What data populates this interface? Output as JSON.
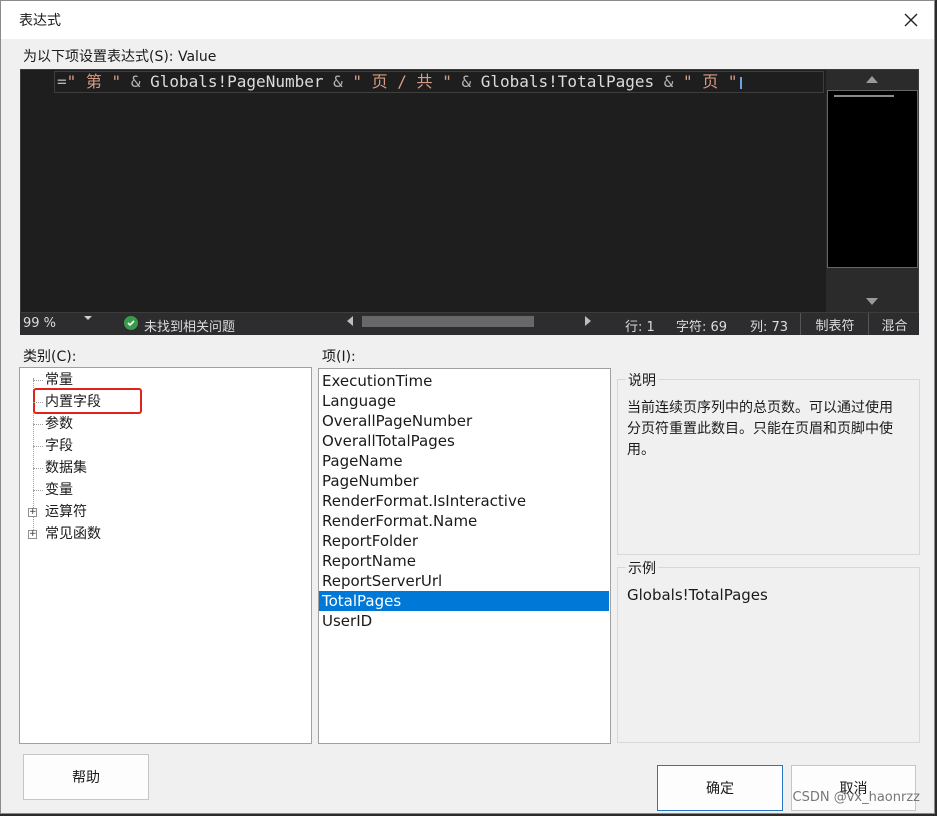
{
  "dialog": {
    "title": "表达式"
  },
  "expression": {
    "label": "为以下项设置表达式(S): Value",
    "tokens": [
      {
        "t": "=",
        "c": "op"
      },
      {
        "t": "\" 第 \"",
        "c": "str"
      },
      {
        "t": " & ",
        "c": "op"
      },
      {
        "t": "Globals!PageNumber",
        "c": "id"
      },
      {
        "t": " & ",
        "c": "op"
      },
      {
        "t": "\" 页 / 共 \"",
        "c": "str"
      },
      {
        "t": " & ",
        "c": "op"
      },
      {
        "t": "Globals!TotalPages",
        "c": "id"
      },
      {
        "t": " & ",
        "c": "op"
      },
      {
        "t": "\" 页 \"",
        "c": "str"
      }
    ]
  },
  "status": {
    "zoom": "99 %",
    "issues": "未找到相关问题",
    "line": "行: 1",
    "chars": "字符: 69",
    "col": "列: 73",
    "tabs": "制表符",
    "mixed": "混合"
  },
  "category": {
    "label": "类别(C):",
    "items": [
      {
        "label": "常量",
        "expandable": false
      },
      {
        "label": "内置字段",
        "expandable": false
      },
      {
        "label": "参数",
        "expandable": false
      },
      {
        "label": "字段",
        "expandable": false
      },
      {
        "label": "数据集",
        "expandable": false
      },
      {
        "label": "变量",
        "expandable": false
      },
      {
        "label": "运算符",
        "expandable": true
      },
      {
        "label": "常见函数",
        "expandable": true
      }
    ]
  },
  "items": {
    "label": "项(I):",
    "list": [
      "ExecutionTime",
      "Language",
      "OverallPageNumber",
      "OverallTotalPages",
      "PageName",
      "PageNumber",
      "RenderFormat.IsInteractive",
      "RenderFormat.Name",
      "ReportFolder",
      "ReportName",
      "ReportServerUrl",
      "TotalPages",
      "UserID"
    ],
    "selected": "TotalPages"
  },
  "description": {
    "title": "说明",
    "text": "当前连续页序列中的总页数。可以通过使用分页符重置此数目。只能在页眉和页脚中使用。"
  },
  "example": {
    "title": "示例",
    "text": "Globals!TotalPages"
  },
  "buttons": {
    "help": "帮助",
    "ok": "确定",
    "cancel": "取消"
  },
  "watermark": "CSDN @vx_haonrzz",
  "colors": {
    "selection": "#0078d7",
    "highlight_box": "#e0241b",
    "string_token": "#d69d85"
  }
}
